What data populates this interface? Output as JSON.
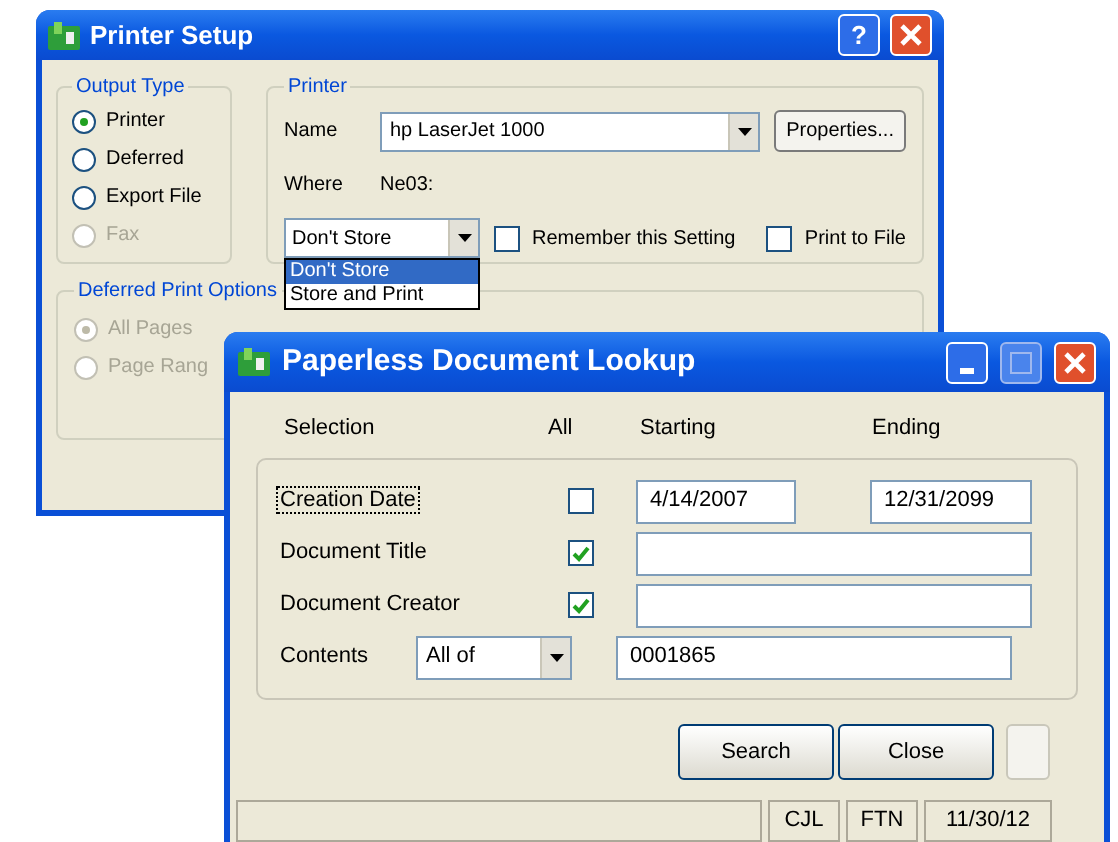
{
  "printer_setup": {
    "title": "Printer Setup",
    "help_button": "?",
    "output_type": {
      "label": "Output Type",
      "options": [
        {
          "label": "Printer",
          "selected": true,
          "disabled": false
        },
        {
          "label": "Deferred",
          "selected": false,
          "disabled": false
        },
        {
          "label": "Export File",
          "selected": false,
          "disabled": false
        },
        {
          "label": "Fax",
          "selected": false,
          "disabled": true
        }
      ]
    },
    "printer": {
      "label": "Printer",
      "name_label": "Name",
      "name_value": "hp LaserJet 1000",
      "properties_button": "Properties...",
      "where_label": "Where",
      "where_value": "Ne03:",
      "store_value": "Don't Store",
      "store_options": [
        {
          "label": "Don't Store",
          "selected": true
        },
        {
          "label": "Store and Print",
          "selected": false
        }
      ],
      "checkboxes": [
        {
          "label": "Remember this Setting",
          "checked": false
        },
        {
          "label": "Print to File",
          "checked": false
        }
      ]
    },
    "deferred": {
      "label": "Deferred Print Options",
      "options": [
        {
          "label": "All Pages",
          "selected": true,
          "disabled": true
        },
        {
          "label": "Page Rang",
          "selected": false,
          "disabled": true
        }
      ]
    }
  },
  "lookup": {
    "title": "Paperless Document Lookup",
    "headers": [
      "Selection",
      "All",
      "Starting",
      "Ending"
    ],
    "rows": [
      {
        "kind": "range",
        "label": "Creation Date",
        "focused": true,
        "all": false,
        "starting": "4/14/2007",
        "ending": "12/31/2099"
      },
      {
        "kind": "text",
        "label": "Document Title",
        "focused": false,
        "all": true
      },
      {
        "kind": "text",
        "label": "Document Creator",
        "focused": false,
        "all": true
      },
      {
        "kind": "contents",
        "label": "Contents",
        "focused": false,
        "mode": "All of",
        "value": "0001865"
      }
    ],
    "buttons": [
      "Search",
      "Close"
    ],
    "status_bar": [
      "CJL",
      "FTN",
      "11/30/12"
    ]
  }
}
